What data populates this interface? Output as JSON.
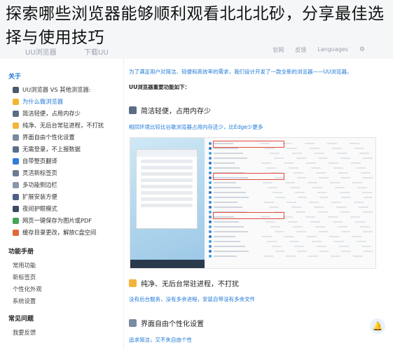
{
  "overlay": {
    "title": "探索哪些浏览器能够顺利观看北北北砂，分享最佳选择与使用技巧"
  },
  "header": {
    "brand": "UU浏览器",
    "download": "下载UU",
    "nav": [
      "官网",
      "反馈",
      "Languages"
    ],
    "settings_icon": "gear-icon"
  },
  "sidebar": {
    "sections": [
      {
        "title": "关于",
        "active": true
      },
      {
        "title": "功能手册"
      },
      {
        "title": "常见问题"
      }
    ],
    "about_items": [
      {
        "label": "UU浏览器 VS 其他浏览器:",
        "icon": "compare-icon",
        "color": "#4a5a70"
      },
      {
        "label": "为什么做浏览器",
        "icon": "idea-icon",
        "color": "#f2b530",
        "active": true
      },
      {
        "label": "简洁轻便，占用内存少",
        "icon": "feather-icon",
        "color": "#5b6d86"
      },
      {
        "label": "纯净、无后台常驻进程，不打扰",
        "icon": "clean-icon",
        "color": "#f4b43a"
      },
      {
        "label": "界面自由个性化设置",
        "icon": "palette-icon",
        "color": "#7a8aa0"
      },
      {
        "label": "无需登录，不上报数据",
        "icon": "shield-icon",
        "color": "#5a6f8a"
      },
      {
        "label": "自带整页翻译",
        "icon": "translate-icon",
        "color": "#2e7dd6"
      },
      {
        "label": "灵活新标签页",
        "icon": "tab-icon",
        "color": "#6b7b92"
      },
      {
        "label": "多功能侧边栏",
        "icon": "sidebar-icon",
        "color": "#8a97aa"
      },
      {
        "label": "扩展安装方便",
        "icon": "puzzle-icon",
        "color": "#4d6282"
      },
      {
        "label": "夜间护眼模式",
        "icon": "moon-icon",
        "color": "#3c4b63"
      },
      {
        "label": "网页一键保存为图片或PDF",
        "icon": "save-icon",
        "color": "#42a55a"
      },
      {
        "label": "缓存目录更改，解放C盘空间",
        "icon": "folder-icon",
        "color": "#e2673a"
      }
    ],
    "manual_items": [
      "常用功能",
      "新标签页",
      "个性化外观",
      "系统设置"
    ],
    "faq_items": [
      "我要反馈"
    ]
  },
  "main": {
    "intro": "为了满足用户对简洁、轻便和高效率的需求，我们设计开发了一款全新的浏览器——UU浏览器。",
    "features_title": "UU浏览器重要功能如下：",
    "feature1_title": "简洁轻便，占用内存少",
    "feature1_desc": "相同环境比较比谷歌浏览器占用内存还少，比Edge少更多",
    "feature2_title": "纯净、无后台常驻进程，不打扰",
    "feature2_desc": "没有后台服务，没有多余进程，安装自带没有多余文件",
    "feature3_title": "界面自由个性化设置",
    "feature3_desc": "追求简洁，又不失自由个性"
  },
  "feedback_icon": "bell-icon"
}
